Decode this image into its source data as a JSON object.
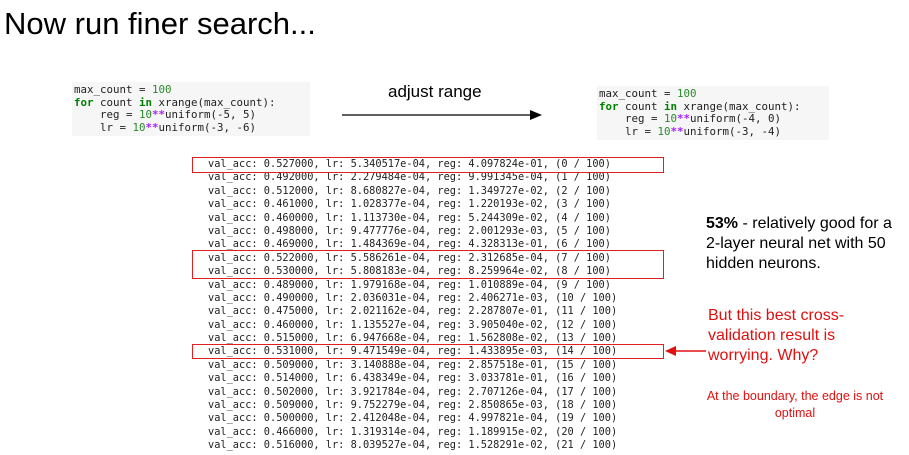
{
  "title": "Now run finer search...",
  "code_left": {
    "line1": [
      "max_count = ",
      "100"
    ],
    "line2": [
      "for",
      " count ",
      "in",
      " xrange(max_count):"
    ],
    "line3": [
      "    reg = ",
      "10",
      "**",
      "uniform(-5, 5)"
    ],
    "line4": [
      "    lr = ",
      "10",
      "**",
      "uniform(-3, -6)"
    ]
  },
  "code_right": {
    "line1": [
      "max_count = ",
      "100"
    ],
    "line2": [
      "for",
      " count ",
      "in",
      " xrange(max_count):"
    ],
    "line3": [
      "    reg = ",
      "10",
      "**",
      "uniform(-4, 0)"
    ],
    "line4": [
      "    lr = ",
      "10",
      "**",
      "uniform(-3, -4)"
    ]
  },
  "adjust_label": "adjust range",
  "log_rows": [
    "val_acc: 0.527000, lr: 5.340517e-04, reg: 4.097824e-01, (0 / 100)",
    "val_acc: 0.492000, lr: 2.279484e-04, reg: 9.991345e-04, (1 / 100)",
    "val_acc: 0.512000, lr: 8.680827e-04, reg: 1.349727e-02, (2 / 100)",
    "val_acc: 0.461000, lr: 1.028377e-04, reg: 1.220193e-02, (3 / 100)",
    "val_acc: 0.460000, lr: 1.113730e-04, reg: 5.244309e-02, (4 / 100)",
    "val_acc: 0.498000, lr: 9.477776e-04, reg: 2.001293e-03, (5 / 100)",
    "val_acc: 0.469000, lr: 1.484369e-04, reg: 4.328313e-01, (6 / 100)",
    "val_acc: 0.522000, lr: 5.586261e-04, reg: 2.312685e-04, (7 / 100)",
    "val_acc: 0.530000, lr: 5.808183e-04, reg: 8.259964e-02, (8 / 100)",
    "val_acc: 0.489000, lr: 1.979168e-04, reg: 1.010889e-04, (9 / 100)",
    "val_acc: 0.490000, lr: 2.036031e-04, reg: 2.406271e-03, (10 / 100)",
    "val_acc: 0.475000, lr: 2.021162e-04, reg: 2.287807e-01, (11 / 100)",
    "val_acc: 0.460000, lr: 1.135527e-04, reg: 3.905040e-02, (12 / 100)",
    "val_acc: 0.515000, lr: 6.947668e-04, reg: 1.562808e-02, (13 / 100)",
    "val_acc: 0.531000, lr: 9.471549e-04, reg: 1.433895e-03, (14 / 100)",
    "val_acc: 0.509000, lr: 3.140888e-04, reg: 2.857518e-01, (15 / 100)",
    "val_acc: 0.514000, lr: 6.438349e-04, reg: 3.033781e-01, (16 / 100)",
    "val_acc: 0.502000, lr: 3.921784e-04, reg: 2.707126e-04, (17 / 100)",
    "val_acc: 0.509000, lr: 9.752279e-04, reg: 2.850865e-03, (18 / 100)",
    "val_acc: 0.500000, lr: 2.412048e-04, reg: 4.997821e-04, (19 / 100)",
    "val_acc: 0.466000, lr: 1.319314e-04, reg: 1.189915e-02, (20 / 100)",
    "val_acc: 0.516000, lr: 8.039527e-04, reg: 1.528291e-02, (21 / 100)"
  ],
  "notes": {
    "bold_part": "53%",
    "rest": " - relatively good for a 2-layer neural net with 50 hidden neurons.",
    "worry": "But this best cross-validation result is worrying. Why?",
    "boundary": "At the boundary, the edge is not optimal"
  },
  "colors": {
    "highlight": "#e02020",
    "warning_text": "#e01010",
    "code_bg": "#f6f6f6"
  }
}
